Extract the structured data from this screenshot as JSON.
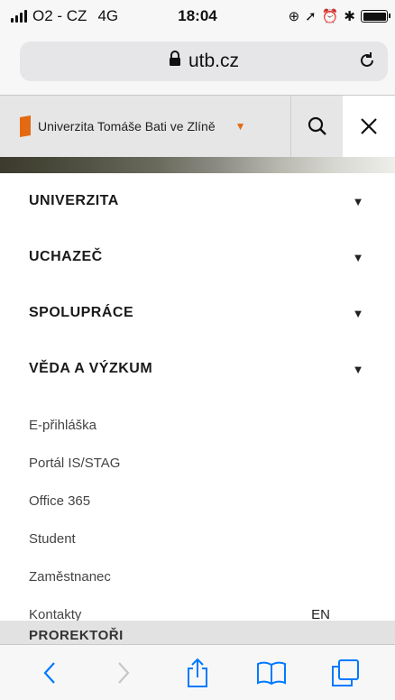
{
  "status_bar": {
    "carrier": "O2 - CZ",
    "network": "4G",
    "time": "18:04"
  },
  "browser": {
    "url": "utb.cz"
  },
  "site_header": {
    "brand_name": "Univerzita Tomáše Bati ve Zlíně"
  },
  "menu": {
    "sections": [
      {
        "label": "UNIVERZITA"
      },
      {
        "label": "UCHAZEČ"
      },
      {
        "label": "SPOLUPRÁCE"
      },
      {
        "label": "VĚDA A VÝZKUM"
      }
    ],
    "links": [
      {
        "label": "E-přihláška"
      },
      {
        "label": "Portál IS/STAG"
      },
      {
        "label": "Office 365"
      },
      {
        "label": "Student"
      },
      {
        "label": "Zaměstnanec"
      },
      {
        "label": "Kontakty"
      }
    ],
    "language": "EN"
  },
  "background_section": "PROREKTOŘI",
  "colors": {
    "accent": "#e36a12",
    "ios_blue": "#007aff"
  }
}
